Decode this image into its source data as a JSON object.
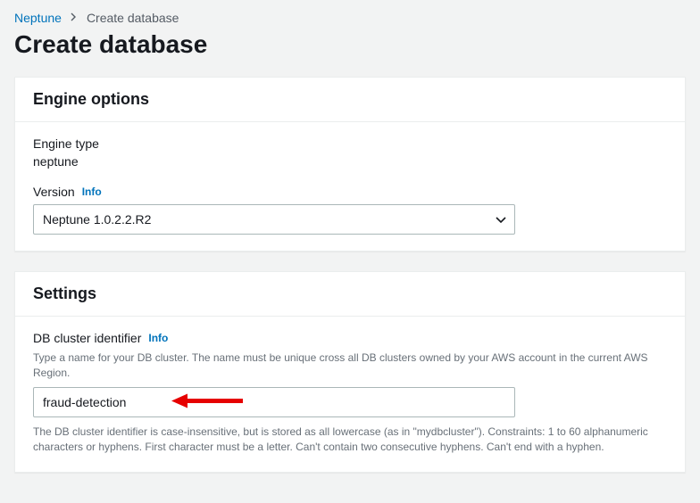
{
  "breadcrumb": {
    "root": "Neptune",
    "current": "Create database"
  },
  "page_title": "Create database",
  "engine_options": {
    "heading": "Engine options",
    "engine_type_label": "Engine type",
    "engine_type_value": "neptune",
    "version_label": "Version",
    "info_label": "Info",
    "version_value": "Neptune 1.0.2.2.R2"
  },
  "settings": {
    "heading": "Settings",
    "cluster_id_label": "DB cluster identifier",
    "info_label": "Info",
    "cluster_id_help_top": "Type a name for your DB cluster. The name must be unique cross all DB clusters owned by your AWS account in the current AWS Region.",
    "cluster_id_value": "fraud-detection",
    "cluster_id_help_bottom": "The DB cluster identifier is case-insensitive, but is stored as all lowercase (as in \"mydbcluster\"). Constraints: 1 to 60 alphanumeric characters or hyphens. First character must be a letter. Can't contain two consecutive hyphens. Can't end with a hyphen."
  }
}
